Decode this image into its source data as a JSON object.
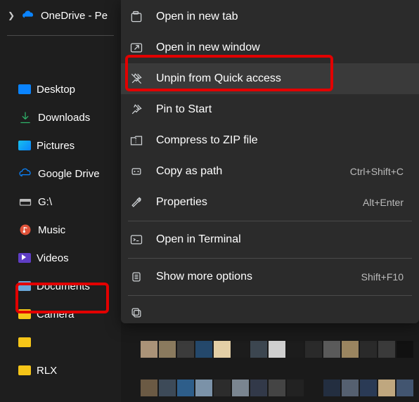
{
  "topbar": {
    "onedrive_label": "OneDrive - Pe"
  },
  "sidebar": {
    "items": [
      {
        "label": "Desktop"
      },
      {
        "label": "Downloads"
      },
      {
        "label": "Pictures"
      },
      {
        "label": "Google Drive"
      },
      {
        "label": "G:\\"
      },
      {
        "label": "Music"
      },
      {
        "label": "Videos"
      },
      {
        "label": "Documents"
      },
      {
        "label": "Camera"
      },
      {
        "label": ""
      },
      {
        "label": "RLX"
      }
    ]
  },
  "context_menu": {
    "items": [
      {
        "label": "Open in new tab",
        "shortcut": ""
      },
      {
        "label": "Open in new window",
        "shortcut": ""
      },
      {
        "label": "Unpin from Quick access",
        "shortcut": ""
      },
      {
        "label": "Pin to Start",
        "shortcut": ""
      },
      {
        "label": "Compress to ZIP file",
        "shortcut": ""
      },
      {
        "label": "Copy as path",
        "shortcut": "Ctrl+Shift+C"
      },
      {
        "label": "Properties",
        "shortcut": "Alt+Enter"
      },
      {
        "label": "Open in Terminal",
        "shortcut": ""
      },
      {
        "label": "Show more options",
        "shortcut": "Shift+F10"
      }
    ]
  }
}
